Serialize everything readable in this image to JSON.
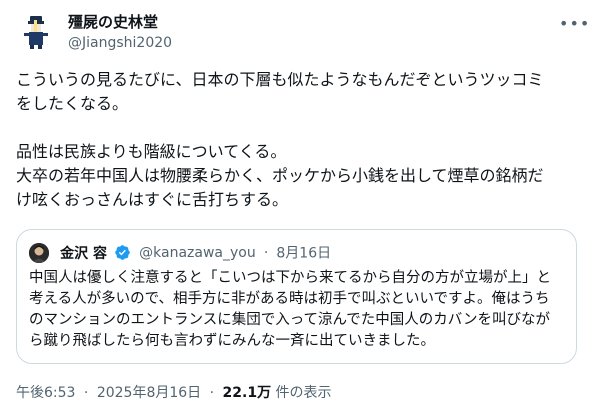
{
  "author": {
    "display_name": "殭屍の史林堂",
    "handle": "@Jiangshi2020"
  },
  "tweet": {
    "lines": [
      "こういうの見るたびに、日本の下層も似たようなもんだぞというツッコミ",
      "をしたくなる。",
      "",
      "品性は民族よりも階級についてくる。",
      "大卒の若年中国人は物腰柔らかく、ポッケから小銭を出して煙草の銘柄だ",
      "け呟くおっさんはすぐに舌打ちする。"
    ]
  },
  "quoted_tweet": {
    "display_name": "金沢 容",
    "handle": "@kanazawa_you",
    "separator": "·",
    "date": "8月16日",
    "lines": [
      "中国人は優しく注意すると「こいつは下から来てるから自分の方が立場が上」と",
      "考える人が多いので、相手方に非がある時は初手で叫ぶといいですよ。俺はうち",
      "のマンションのエントランスに集団で入って涼んでた中国人のカバンを叫びなが",
      "ら蹴り飛ばしたら何も言わずにみんな一斉に出ていきました。"
    ]
  },
  "meta": {
    "time": "午後6:53",
    "separator": "·",
    "date": "2025年8月16日",
    "views_count": "22.1万",
    "views_label": "件の表示"
  },
  "icons": {
    "more": "more-horizontal-icon",
    "verified": "verified-badge-icon"
  },
  "colors": {
    "text": "#0f1419",
    "secondary": "#536471",
    "border": "#cfd9de",
    "verified": "#1d9bf0"
  }
}
